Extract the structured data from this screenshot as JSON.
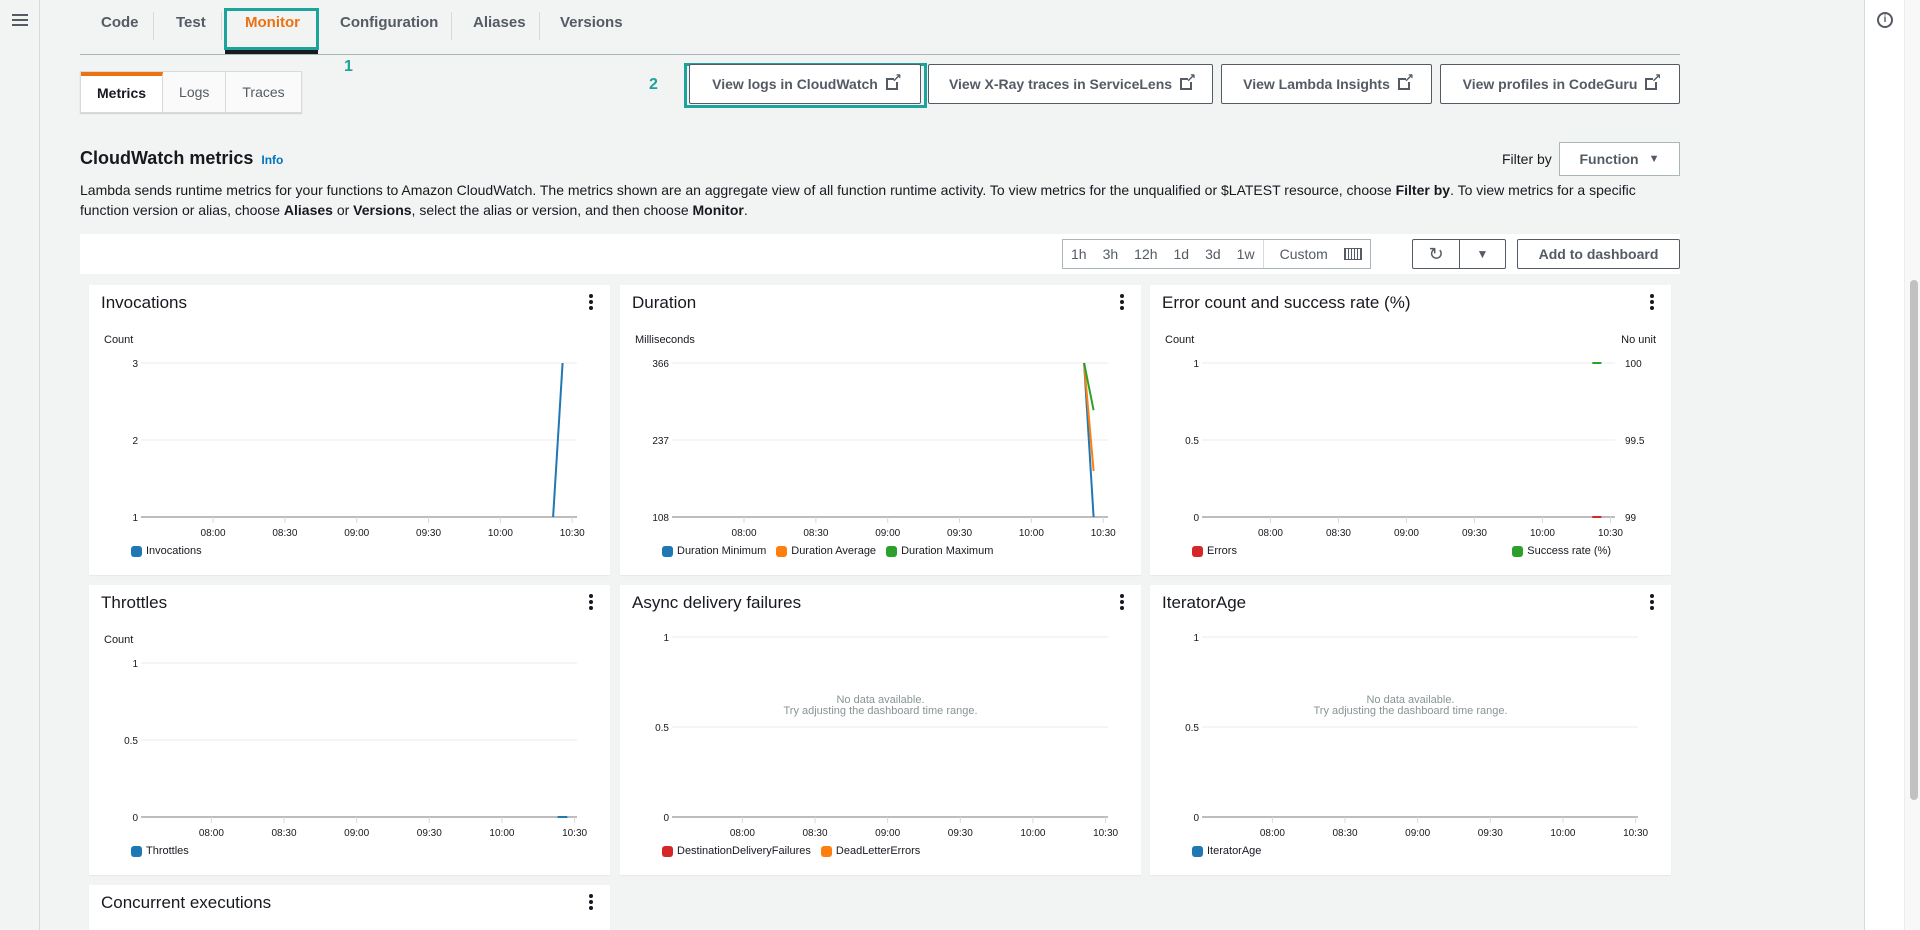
{
  "top_tabs": [
    {
      "label": "Code",
      "active": false
    },
    {
      "label": "Test",
      "active": false
    },
    {
      "label": "Monitor",
      "active": true
    },
    {
      "label": "Configuration",
      "active": false
    },
    {
      "label": "Aliases",
      "active": false
    },
    {
      "label": "Versions",
      "active": false
    }
  ],
  "annotations": {
    "step1": "1",
    "step2": "2",
    "color": "#1ba39c"
  },
  "sub_tabs": [
    {
      "label": "Metrics",
      "active": true
    },
    {
      "label": "Logs",
      "active": false
    },
    {
      "label": "Traces",
      "active": false
    }
  ],
  "external_buttons": [
    {
      "label": "View logs in CloudWatch",
      "icon": "external-link-icon"
    },
    {
      "label": "View X-Ray traces in ServiceLens",
      "icon": "external-link-icon"
    },
    {
      "label": "View Lambda Insights",
      "icon": "external-link-icon"
    },
    {
      "label": "View profiles in CodeGuru",
      "icon": "external-link-icon"
    }
  ],
  "section": {
    "title": "CloudWatch metrics",
    "info": "Info",
    "filter_label": "Filter by",
    "filter_value": "Function",
    "desc_parts": [
      "Lambda sends runtime metrics for your functions to Amazon CloudWatch. The metrics shown are an aggregate view of all function runtime activity. To view metrics for the unqualified or $LATEST resource, choose ",
      "Filter by",
      ". To view metrics for a specific function version or alias, choose ",
      "Aliases",
      " or ",
      "Versions",
      ", select the alias or version, and then choose ",
      "Monitor",
      "."
    ]
  },
  "toolbar": {
    "ranges": [
      "1h",
      "3h",
      "12h",
      "1d",
      "3d",
      "1w"
    ],
    "custom": "Custom",
    "refresh_icon": "refresh-icon",
    "dropdown_icon": "caret-down-icon",
    "add_dashboard": "Add to dashboard"
  },
  "colors": {
    "accent": "#ec7211",
    "blue": "#0073bb",
    "series_blue": "#1f77b4",
    "series_orange": "#ff7f0e",
    "series_green": "#2ca02c",
    "series_red": "#d62728"
  },
  "chart_data": [
    {
      "type": "line",
      "title": "Invocations",
      "ylabel": "Count",
      "ylabel_right": "",
      "x": [
        "08:00",
        "08:30",
        "09:00",
        "09:30",
        "10:00",
        "10:30"
      ],
      "x_range": [
        "07:32",
        "10:32"
      ],
      "y_ticks": [
        "1",
        "2",
        "3"
      ],
      "ylim": [
        1,
        3
      ],
      "series": [
        {
          "name": "Invocations",
          "color": "#1f77b4",
          "points": [
            [
              "10:22",
              1
            ],
            [
              "10:26",
              3
            ]
          ]
        }
      ],
      "no_data": false
    },
    {
      "type": "line",
      "title": "Duration",
      "ylabel": "Milliseconds",
      "ylabel_right": "",
      "x": [
        "08:00",
        "08:30",
        "09:00",
        "09:30",
        "10:00",
        "10:30"
      ],
      "x_range": [
        "07:32",
        "10:32"
      ],
      "y_ticks": [
        "108",
        "237",
        "366"
      ],
      "ylim": [
        108,
        366
      ],
      "series": [
        {
          "name": "Duration Minimum",
          "color": "#1f77b4",
          "points": [
            [
              "10:22",
              366
            ],
            [
              "10:26",
              108
            ]
          ]
        },
        {
          "name": "Duration Average",
          "color": "#ff7f0e",
          "points": [
            [
              "10:22",
              366
            ],
            [
              "10:26",
              185
            ]
          ]
        },
        {
          "name": "Duration Maximum",
          "color": "#2ca02c",
          "points": [
            [
              "10:22",
              366
            ],
            [
              "10:26",
              287
            ]
          ]
        }
      ],
      "no_data": false
    },
    {
      "type": "line",
      "title": "Error count and success rate (%)",
      "ylabel": "Count",
      "ylabel_right": "No unit",
      "x": [
        "08:00",
        "08:30",
        "09:00",
        "09:30",
        "10:00",
        "10:30"
      ],
      "x_range": [
        "07:32",
        "10:32"
      ],
      "y_ticks": [
        "0",
        "0.5",
        "1"
      ],
      "ylim": [
        0,
        1
      ],
      "y_ticks_right": [
        "99",
        "99.5",
        "100"
      ],
      "ylim_right": [
        99,
        100
      ],
      "series": [
        {
          "name": "Errors",
          "color": "#d62728",
          "axis": "left",
          "points": [
            [
              "10:22",
              0
            ],
            [
              "10:26",
              0
            ]
          ]
        },
        {
          "name": "Success rate (%)",
          "color": "#2ca02c",
          "axis": "right",
          "points": [
            [
              "10:22",
              100
            ],
            [
              "10:26",
              100
            ]
          ]
        }
      ],
      "no_data": false
    },
    {
      "type": "line",
      "title": "Throttles",
      "ylabel": "Count",
      "ylabel_right": "",
      "x": [
        "08:00",
        "08:30",
        "09:00",
        "09:30",
        "10:00",
        "10:30"
      ],
      "x_range": [
        "07:33",
        "10:31"
      ],
      "y_ticks": [
        "0",
        "0.5",
        "1"
      ],
      "ylim": [
        0,
        1
      ],
      "series": [
        {
          "name": "Throttles",
          "color": "#1f77b4",
          "points": [
            [
              "10:23",
              0
            ],
            [
              "10:27",
              0
            ]
          ]
        }
      ],
      "no_data": false
    },
    {
      "type": "line",
      "title": "Async delivery failures",
      "ylabel": "",
      "ylabel_right": "",
      "x": [
        "08:00",
        "08:30",
        "09:00",
        "09:30",
        "10:00",
        "10:30"
      ],
      "x_range": [
        "07:33",
        "10:31"
      ],
      "y_ticks": [
        "0",
        "0.5",
        "1"
      ],
      "ylim": [
        0,
        1
      ],
      "series": [
        {
          "name": "DestinationDeliveryFailures",
          "color": "#d62728",
          "points": []
        },
        {
          "name": "DeadLetterErrors",
          "color": "#ff7f0e",
          "points": []
        }
      ],
      "no_data": true,
      "no_data_text": [
        "No data available.",
        "Try adjusting the dashboard time range."
      ]
    },
    {
      "type": "line",
      "title": "IteratorAge",
      "ylabel": "",
      "ylabel_right": "",
      "x": [
        "08:00",
        "08:30",
        "09:00",
        "09:30",
        "10:00",
        "10:30"
      ],
      "x_range": [
        "07:33",
        "10:31"
      ],
      "y_ticks": [
        "0",
        "0.5",
        "1"
      ],
      "ylim": [
        0,
        1
      ],
      "series": [
        {
          "name": "IteratorAge",
          "color": "#1f77b4",
          "points": []
        }
      ],
      "no_data": true,
      "no_data_text": [
        "No data available.",
        "Try adjusting the dashboard time range."
      ]
    },
    {
      "type": "line",
      "title": "Concurrent executions",
      "partial": true
    }
  ]
}
